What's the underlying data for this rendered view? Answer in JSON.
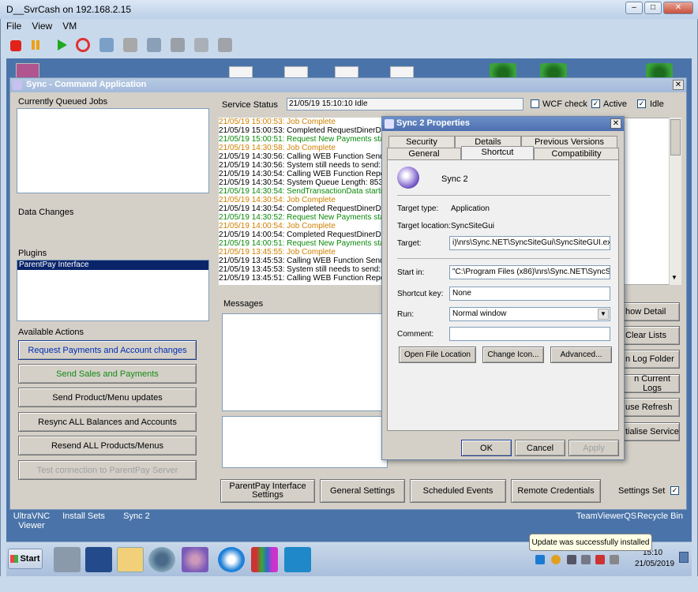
{
  "vm": {
    "title": "D__SvrCash on 192.168.2.15",
    "menu": [
      "File",
      "View",
      "VM"
    ],
    "toolbar_icons": [
      "stop-icon",
      "pause-icon",
      "play-icon",
      "refresh-icon",
      "snapshot-icon",
      "snapshot-manage-icon",
      "settings-icon",
      "send-icon",
      "tools-icon",
      "pointer-icon"
    ]
  },
  "desktop": {
    "labels": [
      "UltraVNC Viewer",
      "Install Sets",
      "Sync 2",
      "TeamViewerQS",
      "Recycle Bin"
    ]
  },
  "sync": {
    "title": "Sync - Command Application",
    "queued_jobs_label": "Currently Queued Jobs",
    "data_changes_label": "Data Changes",
    "plugins_label": "Plugins",
    "plugins": [
      "ParentPay Interface"
    ],
    "available_actions_label": "Available Actions",
    "actions": [
      "Request Payments and Account changes",
      "Send Sales and Payments",
      "Send Product/Menu updates",
      "Resync ALL Balances and Accounts",
      "Resend ALL Products/Menus",
      "Test connection to ParentPay Server"
    ],
    "service_status_label": "Service Status",
    "service_status_value": "21/05/19 15:10:10 Idle",
    "wcf_check_label": "WCF check",
    "active_label": "Active",
    "idle_label": "Idle",
    "messages_label": "Messages",
    "log": [
      {
        "text": "21/05/19 15:00:53: Job Complete",
        "c": "orange"
      },
      {
        "text": "21/05/19 15:00:53: Completed RequestDinerData",
        "c": "black"
      },
      {
        "text": "21/05/19 15:00:51: Request New Payments startin",
        "c": "green"
      },
      {
        "text": "21/05/19 14:30:58: Job Complete",
        "c": "orange"
      },
      {
        "text": "21/05/19 14:30:56: Calling WEB Function SendTr",
        "c": "black"
      },
      {
        "text": "21/05/19 14:30:56: System still needs to send: 35",
        "c": "black"
      },
      {
        "text": "21/05/19 14:30:54: Calling WEB Function ReportC",
        "c": "black"
      },
      {
        "text": "21/05/19 14:30:54: System Queue Length: 853 Re",
        "c": "black"
      },
      {
        "text": "21/05/19 14:30:54: SendTransactionData starting",
        "c": "green"
      },
      {
        "text": "21/05/19 14:30:54: Job Complete",
        "c": "orange"
      },
      {
        "text": "21/05/19 14:30:54: Completed RequestDinerData",
        "c": "black"
      },
      {
        "text": "21/05/19 14:30:52: Request New Payments startin",
        "c": "green"
      },
      {
        "text": "21/05/19 14:00:54: Job Complete",
        "c": "orange"
      },
      {
        "text": "21/05/19 14:00:54: Completed RequestDinerData",
        "c": "black"
      },
      {
        "text": "21/05/19 14:00:51: Request New Payments startin",
        "c": "green"
      },
      {
        "text": "21/05/19 13:45:55: Job Complete",
        "c": "orange"
      },
      {
        "text": "21/05/19 13:45:53: Calling WEB Function SendTr",
        "c": "black"
      },
      {
        "text": "21/05/19 13:45:53: System still needs to send: 85",
        "c": "black"
      },
      {
        "text": "21/05/19 13:45:51: Calling WEB Function ReportC",
        "c": "black"
      }
    ],
    "right_buttons": [
      "how Detail",
      "Clear Lists",
      "n Log Folder",
      "n Current Logs",
      "use Refresh",
      "tialise Service"
    ],
    "bottom_buttons": [
      "ParentPay Interface Settings",
      "General Settings",
      "Scheduled Events",
      "Remote Credentials"
    ],
    "settings_set_label": "Settings Set"
  },
  "props": {
    "title": "Sync 2 Properties",
    "tabs_row1": [
      "Security",
      "Details",
      "Previous Versions"
    ],
    "tabs_row2": [
      "General",
      "Shortcut",
      "Compatibility"
    ],
    "app_name": "Sync 2",
    "target_type_label": "Target type:",
    "target_type_value": "Application",
    "target_location_label": "Target location:",
    "target_location_value": "SyncSiteGui",
    "target_label": "Target:",
    "target_value": "i)\\nrs\\Sync.NET\\SyncSiteGui\\SyncSiteGUI.exe\"",
    "start_in_label": "Start in:",
    "start_in_value": "\"C:\\Program Files (x86)\\nrs\\Sync.NET\\SyncSiteG",
    "shortcut_key_label": "Shortcut key:",
    "shortcut_key_value": "None",
    "run_label": "Run:",
    "run_value": "Normal window",
    "comment_label": "Comment:",
    "comment_value": "",
    "open_file_location": "Open File Location",
    "change_icon": "Change Icon...",
    "advanced": "Advanced...",
    "ok": "OK",
    "cancel": "Cancel",
    "apply": "Apply"
  },
  "taskbar": {
    "start": "Start",
    "balloon": "Update was successfully installed",
    "time": "15:10",
    "date": "21/05/2019"
  }
}
